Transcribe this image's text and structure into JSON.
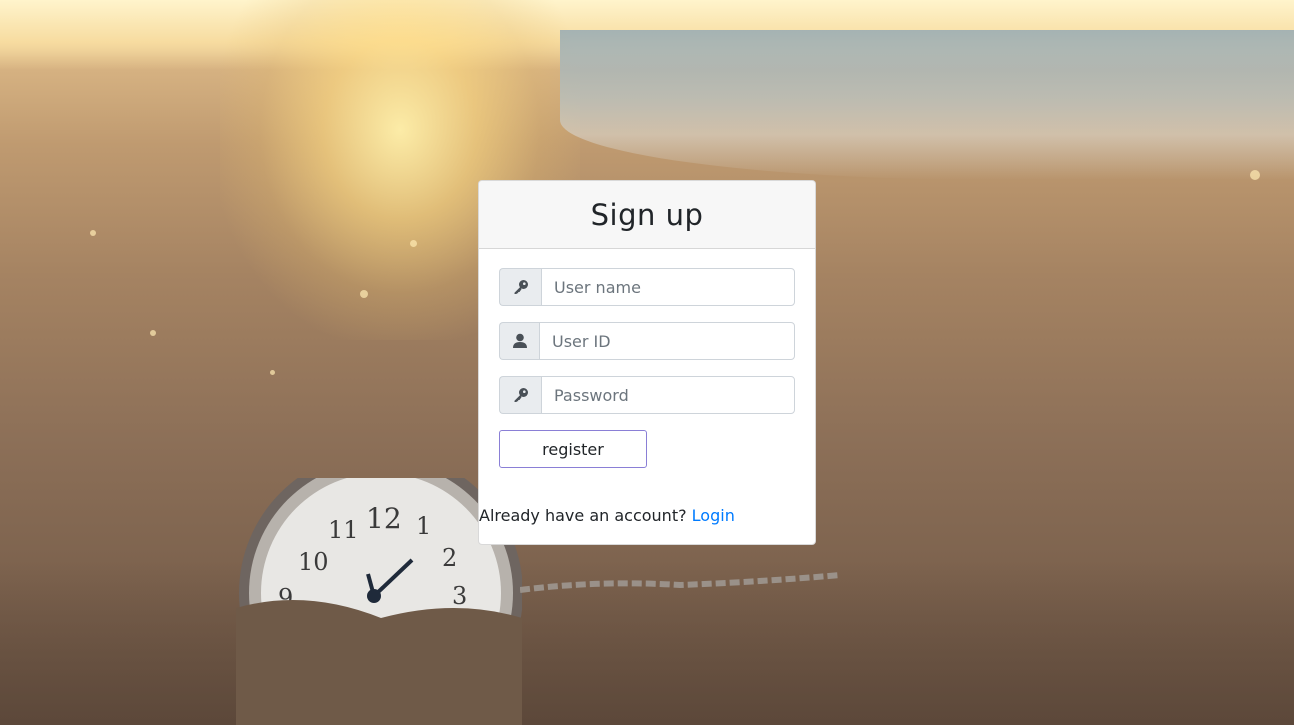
{
  "background": {
    "description_icon": "pocket-watch-on-beach-image"
  },
  "signup": {
    "title": "Sign up",
    "fields": [
      {
        "placeholder": "User name",
        "value": "",
        "icon": "key-icon"
      },
      {
        "placeholder": "User ID",
        "value": "",
        "icon": "user-icon"
      },
      {
        "placeholder": "Password",
        "value": "",
        "icon": "key-icon"
      }
    ],
    "register_label": "register",
    "footer_prompt": "Already have an account? ",
    "login_link": "Login"
  },
  "colors": {
    "link": "#007bff",
    "button_border": "#8a7fd6"
  }
}
